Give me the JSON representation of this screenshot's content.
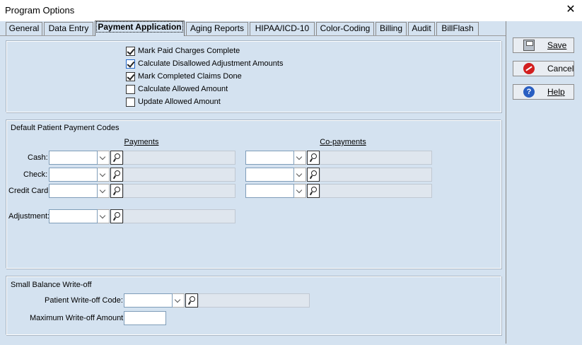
{
  "window": {
    "title": "Program Options",
    "close_glyph": "✕"
  },
  "tabs": [
    {
      "label": "General"
    },
    {
      "label": "Data Entry"
    },
    {
      "label": "Payment Application",
      "active": true
    },
    {
      "label": "Aging Reports"
    },
    {
      "label": "HIPAA/ICD-10"
    },
    {
      "label": "Color-Coding"
    },
    {
      "label": "Billing"
    },
    {
      "label": "Audit"
    },
    {
      "label": "BillFlash"
    }
  ],
  "options": [
    {
      "label": "Mark Paid Charges Complete",
      "checked": true
    },
    {
      "label": "Calculate Disallowed Adjustment Amounts",
      "checked": true
    },
    {
      "label": "Mark Completed Claims Done",
      "checked": true
    },
    {
      "label": "Calculate Allowed Amount",
      "checked": false
    },
    {
      "label": "Update Allowed Amount",
      "checked": false
    }
  ],
  "payment_codes": {
    "title": "Default Patient Payment Codes",
    "payments_header": "Payments",
    "copayments_header": "Co-payments",
    "rows": {
      "cash": "Cash:",
      "check": "Check:",
      "credit_card": "Credit Card:",
      "adjustment": "Adjustment:"
    }
  },
  "writeoff": {
    "title": "Small Balance Write-off",
    "code_label": "Patient Write-off Code:",
    "max_label": "Maximum Write-off Amount:",
    "max_value": ""
  },
  "buttons": {
    "save": "Save",
    "cancel": "Cancel",
    "help": "Help"
  },
  "icons": {
    "save": "floppy-disk-icon",
    "cancel": "cancel-icon",
    "help": "help-question-icon",
    "lookup": "magnifier-icon",
    "dropdown": "chevron-down-icon"
  }
}
